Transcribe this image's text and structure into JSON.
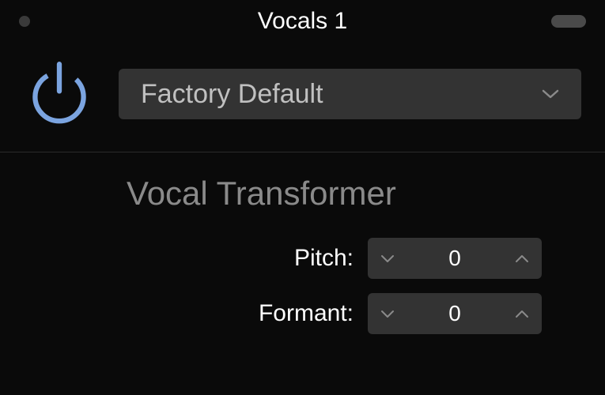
{
  "header": {
    "title": "Vocals 1"
  },
  "preset": {
    "label": "Factory Default"
  },
  "effect": {
    "title": "Vocal Transformer"
  },
  "params": {
    "pitch": {
      "label": "Pitch:",
      "value": "0"
    },
    "formant": {
      "label": "Formant:",
      "value": "0"
    }
  },
  "colors": {
    "power_icon": "#7ba4e0"
  }
}
